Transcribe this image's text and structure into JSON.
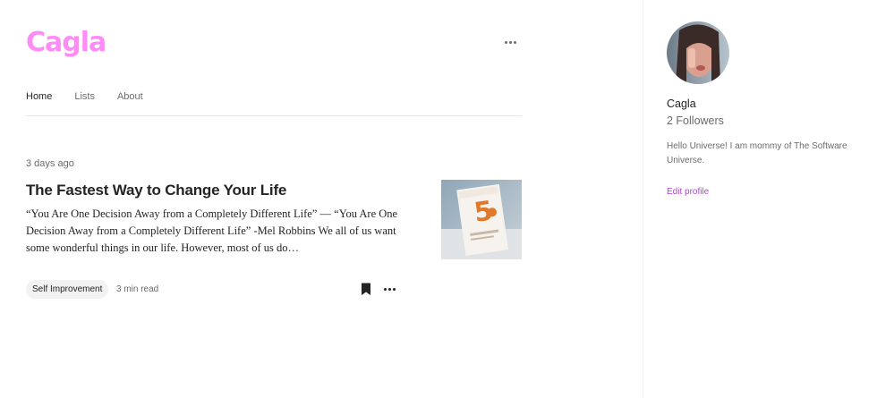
{
  "header": {
    "blog_title": "Cagla",
    "brand_color": "#ff8cf6"
  },
  "tabs": [
    {
      "label": "Home",
      "active": true
    },
    {
      "label": "Lists",
      "active": false
    },
    {
      "label": "About",
      "active": false
    }
  ],
  "post": {
    "date": "3 days ago",
    "title": "The Fastest Way to Change Your Life",
    "excerpt": "“You Are One Decision Away from a Completely Different Life” — “You Are One Decision Away from a Completely Different Life” -Mel Robbins We all of us want some wonderful things in our life. However, most of us do…",
    "tag": "Self Improvement",
    "read_time": "3 min read",
    "icons": [
      "bookmark-icon",
      "more-icon"
    ]
  },
  "sidebar": {
    "name": "Cagla",
    "followers": "2 Followers",
    "bio": "Hello Universe! I am mommy of The Software Universe.",
    "edit_profile": "Edit profile",
    "edit_color": "#a74cc0"
  }
}
